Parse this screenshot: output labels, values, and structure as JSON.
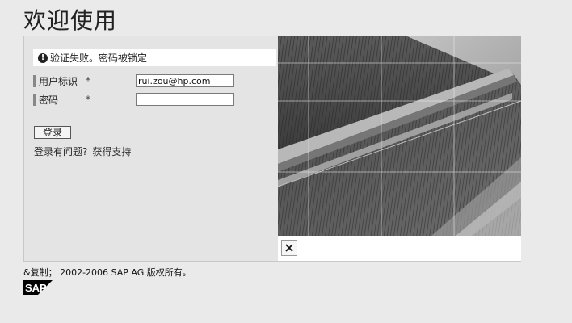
{
  "page": {
    "title": "欢迎使用"
  },
  "message": {
    "text": "验证失败。密码被锁定"
  },
  "form": {
    "user_label": "用户标识",
    "user_required": "*",
    "user_value": "rui.zou@hp.com",
    "password_label": "密码",
    "password_required": "*",
    "password_value": "",
    "login_button": "登录",
    "help_text": "登录有问题?",
    "help_link": "获得支持"
  },
  "footer": {
    "copyright": "&复制；  2002-2006 SAP AG 版权所有。",
    "logo_text": "SAP"
  },
  "icons": {
    "error": "exclamation-circle-icon",
    "broken_image": "broken-image-icon"
  },
  "colors": {
    "background": "#eaeaea",
    "panel": "#e4e4e4",
    "message_bar": "#ffffff",
    "logo": "#000000"
  }
}
